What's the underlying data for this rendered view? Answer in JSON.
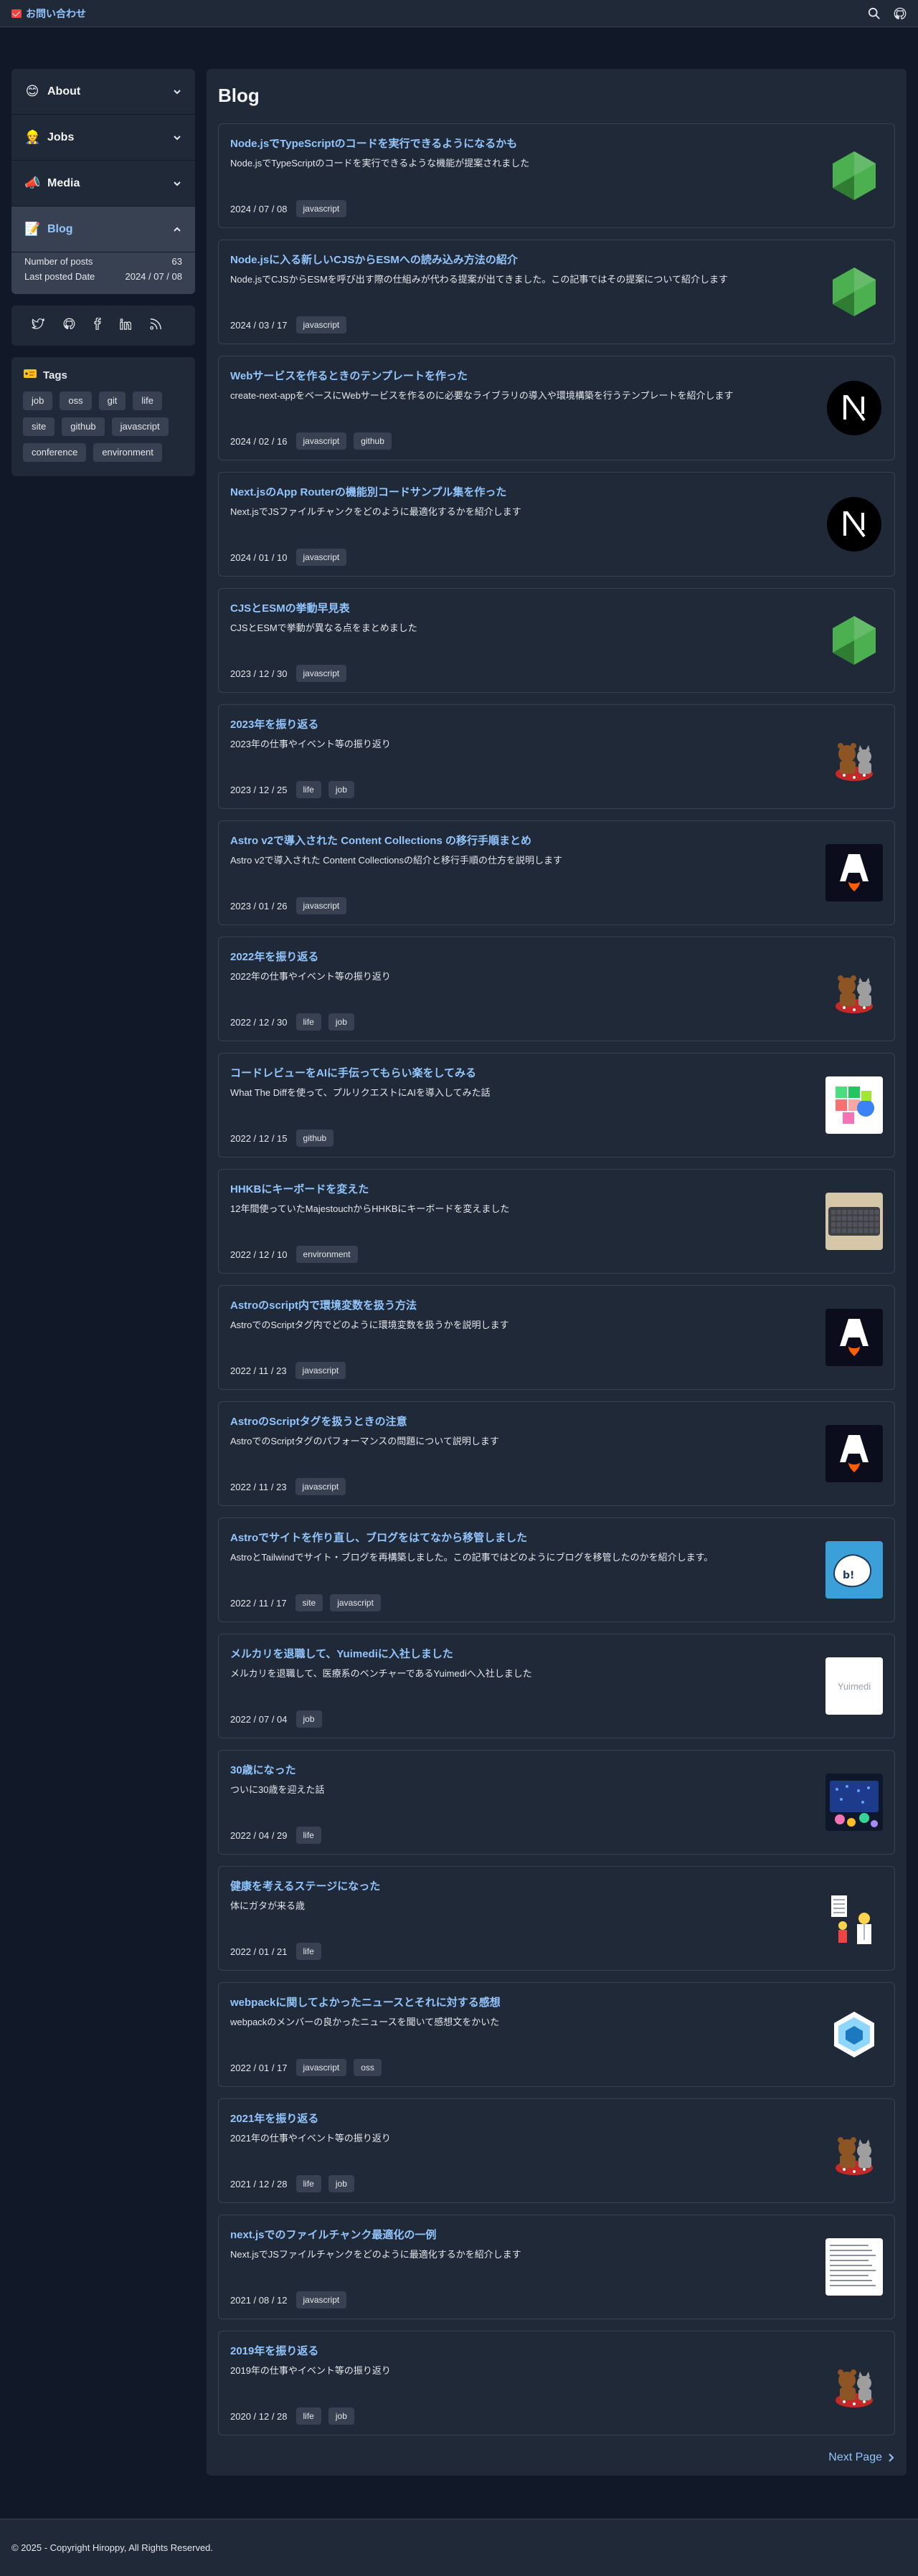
{
  "header": {
    "contact_label": "お問い合わせ",
    "icons": [
      "mail-icon",
      "search-icon",
      "github-icon"
    ]
  },
  "sidebar": {
    "items": [
      {
        "label": "About",
        "emoji": "😊",
        "icon": "smile-icon",
        "expanded": false
      },
      {
        "label": "Jobs",
        "emoji": "👷",
        "icon": "worker-icon",
        "expanded": false
      },
      {
        "label": "Media",
        "emoji": "📣",
        "icon": "megaphone-icon",
        "expanded": false
      },
      {
        "label": "Blog",
        "emoji": "📝",
        "icon": "memo-icon",
        "expanded": true
      }
    ],
    "blog_stats": {
      "posts_label": "Number of posts",
      "posts_value": "63",
      "last_label": "Last posted Date",
      "last_value": "2024 / 07 / 08"
    },
    "social": [
      "twitter-icon",
      "github-icon",
      "facebook-icon",
      "linkedin-icon",
      "rss-icon"
    ],
    "tags_title": "Tags",
    "tags": [
      "job",
      "oss",
      "git",
      "life",
      "site",
      "github",
      "javascript",
      "conference",
      "environment"
    ]
  },
  "main": {
    "title": "Blog",
    "posts": [
      {
        "title": "Node.jsでTypeScriptのコードを実行できるようになるかも",
        "desc": "Node.jsでTypeScriptのコードを実行できるような機能が提案されました",
        "date": "2024 / 07 / 08",
        "tags": [
          "javascript"
        ],
        "thumb": "node"
      },
      {
        "title": "Node.jsに入る新しいCJSからESMへの読み込み方法の紹介",
        "desc": "Node.jsでCJSからESMを呼び出す際の仕組みが代わる提案が出てきました。この記事ではその提案について紹介します",
        "date": "2024 / 03 / 17",
        "tags": [
          "javascript"
        ],
        "thumb": "node"
      },
      {
        "title": "Webサービスを作るときのテンプレートを作った",
        "desc": "create-next-appをベースにWebサービスを作るのに必要なライブラリの導入や環境構築を行うテンプレートを紹介します",
        "date": "2024 / 02 / 16",
        "tags": [
          "javascript",
          "github"
        ],
        "thumb": "next"
      },
      {
        "title": "Next.jsのApp Routerの機能別コードサンプル集を作った",
        "desc": "Next.jsでJSファイルチャンクをどのように最適化するかを紹介します",
        "date": "2024 / 01 / 10",
        "tags": [
          "javascript"
        ],
        "thumb": "next"
      },
      {
        "title": "CJSとESMの挙動早見表",
        "desc": "CJSとESMで挙動が異なる点をまとめました",
        "date": "2023 / 12 / 30",
        "tags": [
          "javascript"
        ],
        "thumb": "node"
      },
      {
        "title": "2023年を振り返る",
        "desc": "2023年の仕事やイベント等の振り返り",
        "date": "2023 / 12 / 25",
        "tags": [
          "life",
          "job"
        ],
        "thumb": "bear"
      },
      {
        "title": "Astro v2で導入された Content Collections の移行手順まとめ",
        "desc": "Astro v2で導入された Content Collectionsの紹介と移行手順の仕方を説明します",
        "date": "2023 / 01 / 26",
        "tags": [
          "javascript"
        ],
        "thumb": "astro"
      },
      {
        "title": "2022年を振り返る",
        "desc": "2022年の仕事やイベント等の振り返り",
        "date": "2022 / 12 / 30",
        "tags": [
          "life",
          "job"
        ],
        "thumb": "bear"
      },
      {
        "title": "コードレビューをAIに手伝ってもらい楽をしてみる",
        "desc": "What The Diffを使って、プルリクエストにAIを導入してみた話",
        "date": "2022 / 12 / 15",
        "tags": [
          "github"
        ],
        "thumb": "wtd"
      },
      {
        "title": "HHKBにキーボードを変えた",
        "desc": "12年間使っていたMajestouchからHHKBにキーボードを変えました",
        "date": "2022 / 12 / 10",
        "tags": [
          "environment"
        ],
        "thumb": "keyboard"
      },
      {
        "title": "Astroのscript内で環境変数を扱う方法",
        "desc": "AstroでのScriptタグ内でどのように環境変数を扱うかを説明します",
        "date": "2022 / 11 / 23",
        "tags": [
          "javascript"
        ],
        "thumb": "astro"
      },
      {
        "title": "AstroのScriptタグを扱うときの注意",
        "desc": "AstroでのScriptタグのパフォーマンスの問題について説明します",
        "date": "2022 / 11 / 23",
        "tags": [
          "javascript"
        ],
        "thumb": "astro"
      },
      {
        "title": "Astroでサイトを作り直し、ブログをはてなから移管しました",
        "desc": "AstroとTailwindでサイト・ブログを再構築しました。この記事ではどのようにブログを移管したのかを紹介します。",
        "date": "2022 / 11 / 17",
        "tags": [
          "site",
          "javascript"
        ],
        "thumb": "hatena"
      },
      {
        "title": "メルカリを退職して、Yuimediに入社しました",
        "desc": "メルカリを退職して、医療系のベンチャーであるYuimediへ入社しました",
        "date": "2022 / 07 / 04",
        "tags": [
          "job"
        ],
        "thumb": "yuimedi",
        "thumb_text": "Yuimedi"
      },
      {
        "title": "30歳になった",
        "desc": "ついに30歳を迎えた話",
        "date": "2022 / 04 / 29",
        "tags": [
          "life"
        ],
        "thumb": "party"
      },
      {
        "title": "健康を考えるステージになった",
        "desc": "体にガタが来る歳",
        "date": "2022 / 01 / 21",
        "tags": [
          "life"
        ],
        "thumb": "doctor"
      },
      {
        "title": "webpackに関してよかったニュースとそれに対する感想",
        "desc": "webpackのメンバーの良かったニュースを聞いて感想文をかいた",
        "date": "2022 / 01 / 17",
        "tags": [
          "javascript",
          "oss"
        ],
        "thumb": "webpack"
      },
      {
        "title": "2021年を振り返る",
        "desc": "2021年の仕事やイベント等の振り返り",
        "date": "2021 / 12 / 28",
        "tags": [
          "life",
          "job"
        ],
        "thumb": "bear"
      },
      {
        "title": "next.jsでのファイルチャンク最適化の一例",
        "desc": "Next.jsでJSファイルチャンクをどのように最適化するかを紹介します",
        "date": "2021 / 08 / 12",
        "tags": [
          "javascript"
        ],
        "thumb": "doc"
      },
      {
        "title": "2019年を振り返る",
        "desc": "2019年の仕事やイベント等の振り返り",
        "date": "2020 / 12 / 28",
        "tags": [
          "life",
          "job"
        ],
        "thumb": "bear"
      }
    ],
    "next_page_label": "Next Page"
  },
  "footer": {
    "copyright": "© 2025 - Copyright Hiroppy, All Rights Reserved."
  },
  "colors": {
    "page_bg": "#111827",
    "panel_bg": "#1f2937",
    "border": "#374151",
    "link": "#93c5fd",
    "text": "#e5e7eb"
  }
}
